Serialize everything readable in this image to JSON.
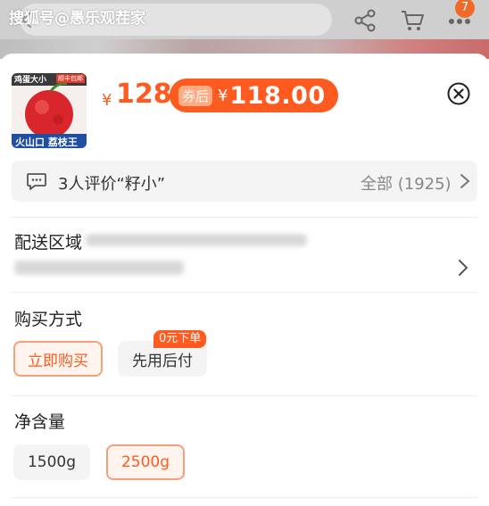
{
  "top": {
    "watermark": "搜狐号@愚乐观茬家",
    "cart_badge": "7"
  },
  "product": {
    "thumb_top_label": "鸡蛋大小",
    "thumb_brand": "顺丰包邮",
    "thumb_bottom_label": "火山口 荔枝王",
    "price_prefix": "¥",
    "price": "128",
    "coupon_tag": "券后",
    "coupon_yen": "¥",
    "coupon_price": "118.00"
  },
  "review": {
    "text": "3人评价“籽小”",
    "all": "全部 (1925)"
  },
  "delivery": {
    "title": "配送区域"
  },
  "purchase": {
    "title": "购买方式",
    "options": [
      "立即购买",
      "先用后付"
    ],
    "badge": "0元下单"
  },
  "net": {
    "title": "净含量",
    "options": [
      "1500g",
      "2500g"
    ]
  },
  "colors": {
    "accent": "#ff5a1f",
    "selected_border": "#f6a07a"
  }
}
